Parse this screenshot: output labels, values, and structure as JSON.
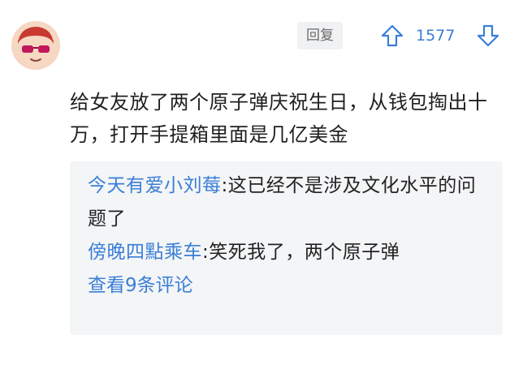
{
  "comment": {
    "reply_label": "回复",
    "vote_count": "1577",
    "text": "给女友放了两个原子弹庆祝生日，从钱包掏出十万，打开手提箱里面是几亿美金"
  },
  "replies": {
    "items": [
      {
        "author": "今天有爱小刘莓",
        "separator": ":",
        "text": "这已经不是涉及文化水平的问题了"
      },
      {
        "author": "傍晚四點乘车",
        "separator": ":",
        "text": "笑死我了，两个原子弹"
      }
    ],
    "view_more_label": "查看9条评论"
  },
  "colors": {
    "accent": "#3a7fd6",
    "reply_bg": "#f4f5f7",
    "button_bg": "#f0f1f3"
  },
  "icons": {
    "upvote": "arrow-up-icon",
    "downvote": "arrow-down-icon"
  }
}
